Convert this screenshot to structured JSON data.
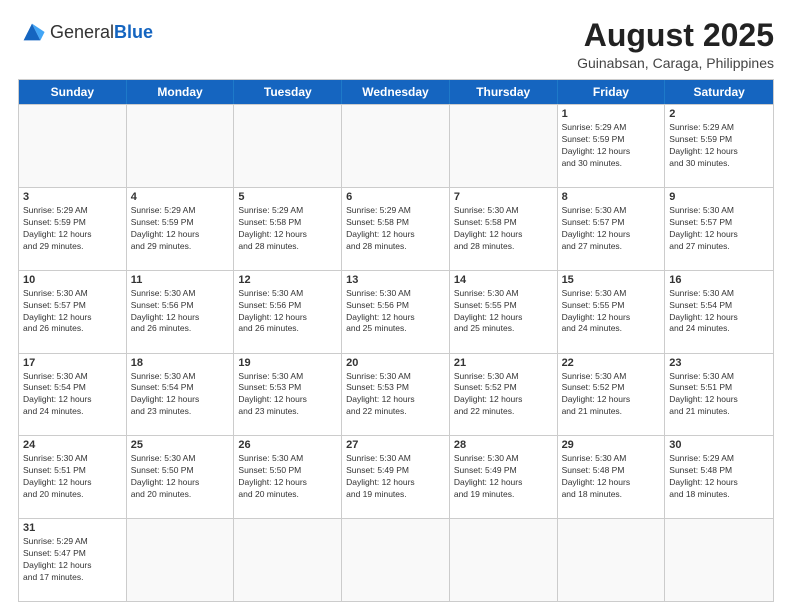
{
  "logo": {
    "text_general": "General",
    "text_blue": "Blue"
  },
  "header": {
    "month_year": "August 2025",
    "location": "Guinabsan, Caraga, Philippines"
  },
  "weekdays": [
    "Sunday",
    "Monday",
    "Tuesday",
    "Wednesday",
    "Thursday",
    "Friday",
    "Saturday"
  ],
  "rows": [
    [
      {
        "day": "",
        "info": ""
      },
      {
        "day": "",
        "info": ""
      },
      {
        "day": "",
        "info": ""
      },
      {
        "day": "",
        "info": ""
      },
      {
        "day": "",
        "info": ""
      },
      {
        "day": "1",
        "info": "Sunrise: 5:29 AM\nSunset: 5:59 PM\nDaylight: 12 hours\nand 30 minutes."
      },
      {
        "day": "2",
        "info": "Sunrise: 5:29 AM\nSunset: 5:59 PM\nDaylight: 12 hours\nand 30 minutes."
      }
    ],
    [
      {
        "day": "3",
        "info": "Sunrise: 5:29 AM\nSunset: 5:59 PM\nDaylight: 12 hours\nand 29 minutes."
      },
      {
        "day": "4",
        "info": "Sunrise: 5:29 AM\nSunset: 5:59 PM\nDaylight: 12 hours\nand 29 minutes."
      },
      {
        "day": "5",
        "info": "Sunrise: 5:29 AM\nSunset: 5:58 PM\nDaylight: 12 hours\nand 28 minutes."
      },
      {
        "day": "6",
        "info": "Sunrise: 5:29 AM\nSunset: 5:58 PM\nDaylight: 12 hours\nand 28 minutes."
      },
      {
        "day": "7",
        "info": "Sunrise: 5:30 AM\nSunset: 5:58 PM\nDaylight: 12 hours\nand 28 minutes."
      },
      {
        "day": "8",
        "info": "Sunrise: 5:30 AM\nSunset: 5:57 PM\nDaylight: 12 hours\nand 27 minutes."
      },
      {
        "day": "9",
        "info": "Sunrise: 5:30 AM\nSunset: 5:57 PM\nDaylight: 12 hours\nand 27 minutes."
      }
    ],
    [
      {
        "day": "10",
        "info": "Sunrise: 5:30 AM\nSunset: 5:57 PM\nDaylight: 12 hours\nand 26 minutes."
      },
      {
        "day": "11",
        "info": "Sunrise: 5:30 AM\nSunset: 5:56 PM\nDaylight: 12 hours\nand 26 minutes."
      },
      {
        "day": "12",
        "info": "Sunrise: 5:30 AM\nSunset: 5:56 PM\nDaylight: 12 hours\nand 26 minutes."
      },
      {
        "day": "13",
        "info": "Sunrise: 5:30 AM\nSunset: 5:56 PM\nDaylight: 12 hours\nand 25 minutes."
      },
      {
        "day": "14",
        "info": "Sunrise: 5:30 AM\nSunset: 5:55 PM\nDaylight: 12 hours\nand 25 minutes."
      },
      {
        "day": "15",
        "info": "Sunrise: 5:30 AM\nSunset: 5:55 PM\nDaylight: 12 hours\nand 24 minutes."
      },
      {
        "day": "16",
        "info": "Sunrise: 5:30 AM\nSunset: 5:54 PM\nDaylight: 12 hours\nand 24 minutes."
      }
    ],
    [
      {
        "day": "17",
        "info": "Sunrise: 5:30 AM\nSunset: 5:54 PM\nDaylight: 12 hours\nand 24 minutes."
      },
      {
        "day": "18",
        "info": "Sunrise: 5:30 AM\nSunset: 5:54 PM\nDaylight: 12 hours\nand 23 minutes."
      },
      {
        "day": "19",
        "info": "Sunrise: 5:30 AM\nSunset: 5:53 PM\nDaylight: 12 hours\nand 23 minutes."
      },
      {
        "day": "20",
        "info": "Sunrise: 5:30 AM\nSunset: 5:53 PM\nDaylight: 12 hours\nand 22 minutes."
      },
      {
        "day": "21",
        "info": "Sunrise: 5:30 AM\nSunset: 5:52 PM\nDaylight: 12 hours\nand 22 minutes."
      },
      {
        "day": "22",
        "info": "Sunrise: 5:30 AM\nSunset: 5:52 PM\nDaylight: 12 hours\nand 21 minutes."
      },
      {
        "day": "23",
        "info": "Sunrise: 5:30 AM\nSunset: 5:51 PM\nDaylight: 12 hours\nand 21 minutes."
      }
    ],
    [
      {
        "day": "24",
        "info": "Sunrise: 5:30 AM\nSunset: 5:51 PM\nDaylight: 12 hours\nand 20 minutes."
      },
      {
        "day": "25",
        "info": "Sunrise: 5:30 AM\nSunset: 5:50 PM\nDaylight: 12 hours\nand 20 minutes."
      },
      {
        "day": "26",
        "info": "Sunrise: 5:30 AM\nSunset: 5:50 PM\nDaylight: 12 hours\nand 20 minutes."
      },
      {
        "day": "27",
        "info": "Sunrise: 5:30 AM\nSunset: 5:49 PM\nDaylight: 12 hours\nand 19 minutes."
      },
      {
        "day": "28",
        "info": "Sunrise: 5:30 AM\nSunset: 5:49 PM\nDaylight: 12 hours\nand 19 minutes."
      },
      {
        "day": "29",
        "info": "Sunrise: 5:30 AM\nSunset: 5:48 PM\nDaylight: 12 hours\nand 18 minutes."
      },
      {
        "day": "30",
        "info": "Sunrise: 5:29 AM\nSunset: 5:48 PM\nDaylight: 12 hours\nand 18 minutes."
      }
    ],
    [
      {
        "day": "31",
        "info": "Sunrise: 5:29 AM\nSunset: 5:47 PM\nDaylight: 12 hours\nand 17 minutes."
      },
      {
        "day": "",
        "info": ""
      },
      {
        "day": "",
        "info": ""
      },
      {
        "day": "",
        "info": ""
      },
      {
        "day": "",
        "info": ""
      },
      {
        "day": "",
        "info": ""
      },
      {
        "day": "",
        "info": ""
      }
    ]
  ]
}
